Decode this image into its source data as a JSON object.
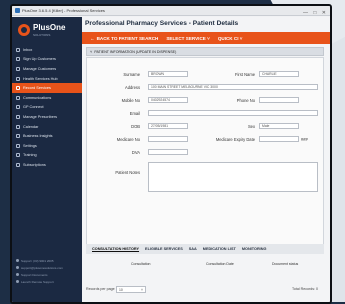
{
  "window": {
    "title": "PlusOne 3.6.5.4 [Killer] - Professional Services"
  },
  "brand": {
    "name": "PlusOne",
    "tagline": "SOLUTIONS"
  },
  "sidebar": {
    "items": [
      {
        "label": "Inbox"
      },
      {
        "label": "Sign Up Customers"
      },
      {
        "label": "Manage Customers"
      },
      {
        "label": "Health Services Hub"
      },
      {
        "label": "Record Services"
      },
      {
        "label": "Communications"
      },
      {
        "label": "GP Connect"
      },
      {
        "label": "Manage Prescribers"
      },
      {
        "label": "Calendar"
      },
      {
        "label": "Business Insights"
      },
      {
        "label": "Settings"
      },
      {
        "label": "Training"
      },
      {
        "label": "Subscriptions"
      }
    ],
    "active_index": 4,
    "bottom_links": [
      "Support: (03) 9001 2005",
      "support@plusonesolutions.com",
      "Support Documents",
      "Launch Remote Support"
    ]
  },
  "page": {
    "title": "Professional Pharmacy Services - Patient Details"
  },
  "toolbar": {
    "back_label": "BACK TO PATIENT SEARCH",
    "select_label": "SELECT SERVICE",
    "quick_label": "QUICK CI"
  },
  "section": {
    "title": "PATIENT INFORMATION (UPDATE IN DISPENSE)"
  },
  "form": {
    "surname_label": "Surname",
    "surname": "BROWN",
    "first_name_label": "First Name",
    "first_name": "CHARLIE",
    "address_label": "Address",
    "address": "100 MAIN STREET MELBOURNE VIC 3000",
    "mobile_label": "Mobile No",
    "mobile": "0402924574",
    "phone_label": "Phone No",
    "phone": "",
    "email_label": "Email",
    "email": "",
    "dob_label": "DOB",
    "dob": "27/05/1981",
    "sex_label": "Sex",
    "sex": "Male",
    "medicare_label": "Medicare No",
    "medicare": "",
    "medicare_expiry_label": "Medicare Expiry Date",
    "medicare_expiry": "",
    "medicare_expiry_suffix": "###",
    "dva_label": "DVA",
    "dva": "",
    "notes_label": "Patient Notes"
  },
  "tabs": [
    "CONSULTATION HISTORY",
    "ELIGIBLE SERVICES",
    "SAA",
    "MEDICATION LIST",
    "MONITORING"
  ],
  "table": {
    "columns": [
      "Consultation",
      "Consultation Date",
      "Document status"
    ]
  },
  "footer": {
    "per_page_label": "Records per page",
    "per_page_value": "10",
    "total_label": "Total Records: 0"
  },
  "colors": {
    "accent": "#e8531a",
    "sidebar": "#1b2942"
  }
}
